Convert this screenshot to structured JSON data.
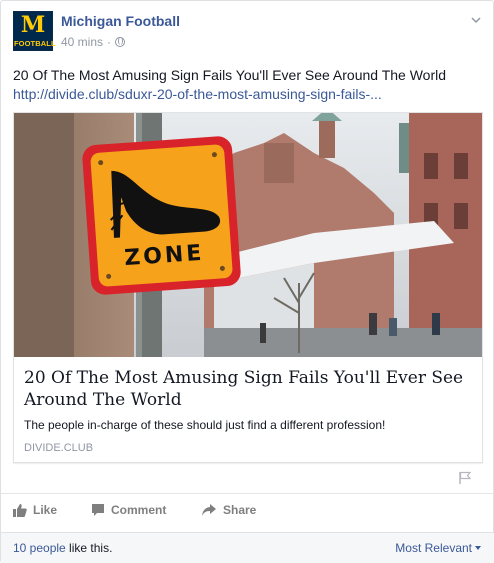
{
  "post": {
    "page_name": "Michigan Football",
    "avatar": {
      "letter": "M",
      "caption": "FOOTBALL"
    },
    "time": "40 mins",
    "separator": "·",
    "privacy_icon": "globe-icon",
    "menu_icon": "chevron-down-icon",
    "text": "20 Of The Most Amusing Sign Fails You'll Ever See Around The World",
    "link_text": "http://divide.club/sduxr-20-of-the-most-amusing-sign-fails-..."
  },
  "shared_link": {
    "sign_text": "ZONE",
    "title": "20 Of The Most Amusing Sign Fails You'll Ever See Around The World",
    "description": "The people in-charge of these should just find a different profession!",
    "domain": "DIVIDE.CLUB"
  },
  "actions": {
    "like": "Like",
    "comment": "Comment",
    "share": "Share"
  },
  "likes": {
    "count_text": "10 people",
    "suffix": " like this.",
    "sort_label": "Most Relevant"
  },
  "colors": {
    "brand_blue": "#3b5998",
    "michigan_navy": "#00274c",
    "michigan_maize": "#ffcb05",
    "sign_orange": "#f6a21b",
    "sign_red": "#d8232a"
  }
}
